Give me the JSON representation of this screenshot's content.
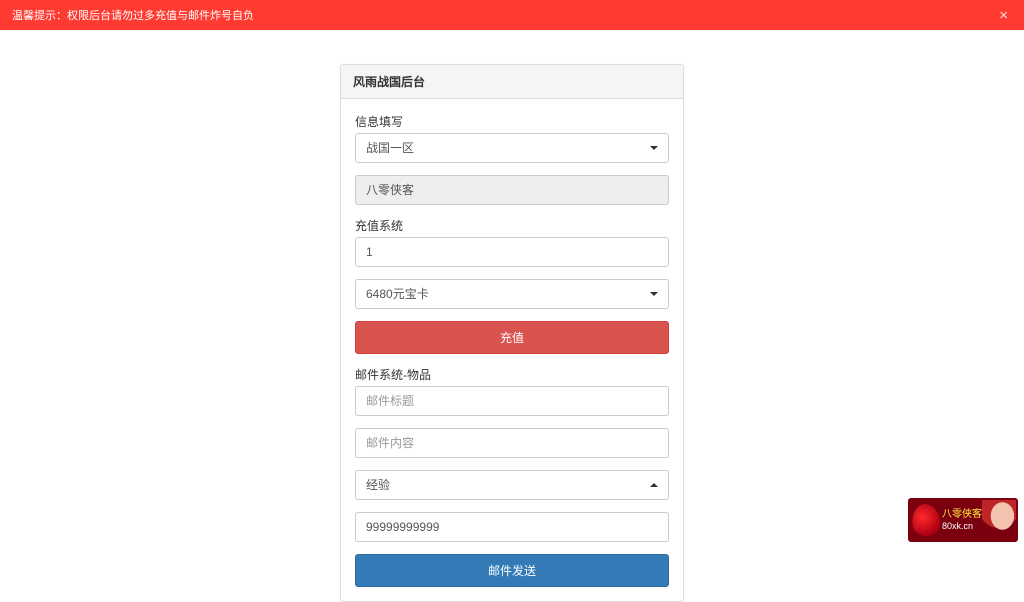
{
  "alert": {
    "text": "温馨提示：权限后台请勿过多充值与邮件炸号自负",
    "close": "×"
  },
  "panel": {
    "title": "风雨战国后台"
  },
  "section_info": {
    "label": "信息填写",
    "server_selected": "战国一区",
    "account_readonly": "八零侠客"
  },
  "section_recharge": {
    "label": "充值系统",
    "count_value": "1",
    "card_selected": "6480元宝卡",
    "button": "充值"
  },
  "section_mail": {
    "label": "邮件系统-物品",
    "title_placeholder": "邮件标题",
    "content_placeholder": "邮件内容",
    "item_selected": "经验",
    "amount_value": "99999999999",
    "button": "邮件发送"
  },
  "watermark": {
    "title": "八零侠客",
    "url": "80xk.cn"
  }
}
